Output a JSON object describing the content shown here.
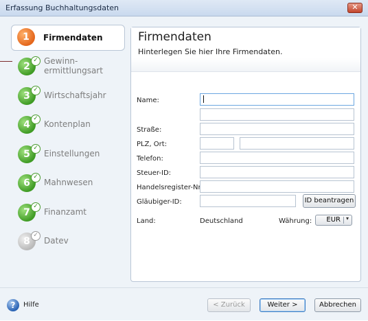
{
  "window": {
    "title": "Erfassung Buchhaltungsdaten",
    "close_glyph": "✕"
  },
  "steps": [
    {
      "number": "1",
      "label": "Firmendaten",
      "state": "active"
    },
    {
      "number": "2",
      "label_line1": "Gewinn-",
      "label_line2": "ermittlungsart",
      "state": "done"
    },
    {
      "number": "3",
      "label": "Wirtschaftsjahr",
      "state": "done"
    },
    {
      "number": "4",
      "label": "Kontenplan",
      "state": "done"
    },
    {
      "number": "5",
      "label": "Einstellungen",
      "state": "done"
    },
    {
      "number": "6",
      "label": "Mahnwesen",
      "state": "done"
    },
    {
      "number": "7",
      "label": "Finanzamt",
      "state": "done"
    },
    {
      "number": "8",
      "label": "Datev",
      "state": "disabled"
    }
  ],
  "panel": {
    "title": "Firmendaten",
    "subtitle": "Hinterlegen Sie hier Ihre Firmendaten."
  },
  "form": {
    "name_label": "Name:",
    "street_label": "Straße:",
    "zip_city_label": "PLZ, Ort:",
    "phone_label": "Telefon:",
    "tax_id_label": "Steuer-ID:",
    "register_label": "Handelsregister-Nr.:",
    "creditor_label": "Gläubiger-ID:",
    "creditor_button": "ID beantragen",
    "country_label": "Land:",
    "country_value": "Deutschland",
    "currency_label": "Währung:",
    "currency_value": "EUR",
    "values": {
      "name": "",
      "name2": "",
      "street": "",
      "zip": "",
      "city": "",
      "phone": "",
      "tax_id": "",
      "register": "",
      "creditor": ""
    }
  },
  "footer": {
    "help_label": "Hilfe",
    "help_glyph": "?",
    "back_label": "< Zurück",
    "next_label": "Weiter >",
    "cancel_label": "Abbrechen"
  },
  "colors": {
    "accent_active": "#e4661b",
    "accent_done": "#3f9b24",
    "disabled": "#b9b9b9",
    "close": "#c2452c"
  },
  "icons": {
    "check": "✓",
    "dropdown": "▾"
  }
}
